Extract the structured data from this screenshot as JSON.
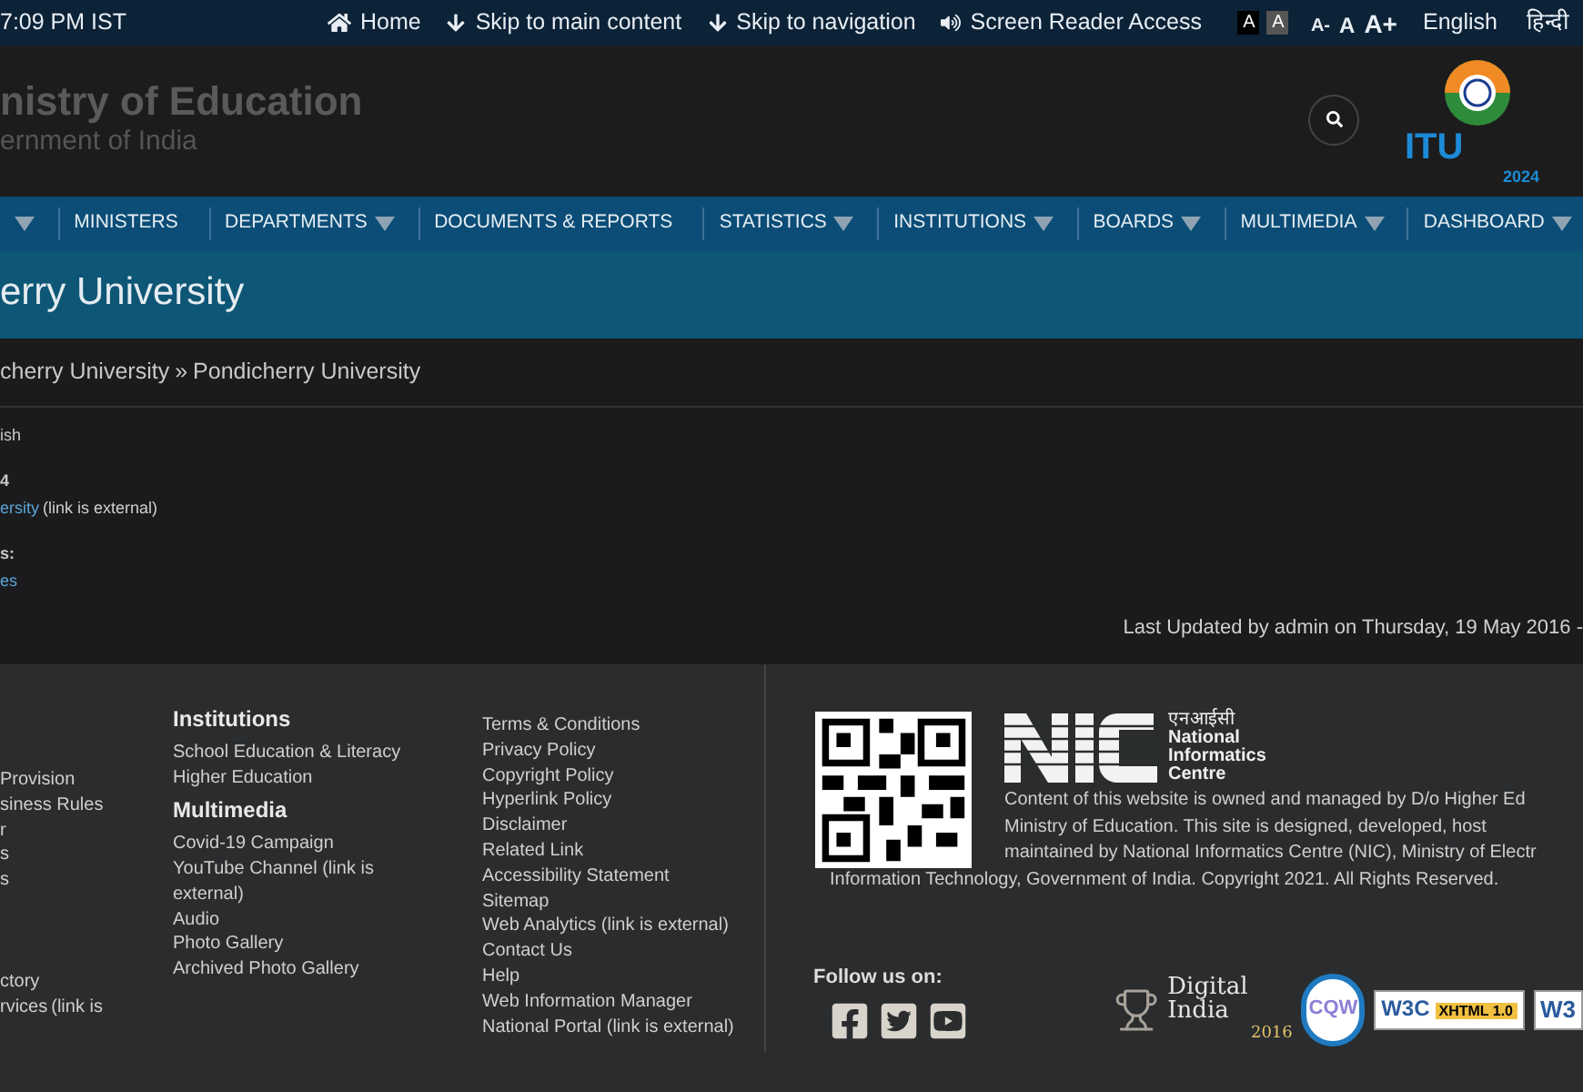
{
  "top_bar": {
    "time": "7:09 PM IST",
    "links": [
      {
        "kind": "home",
        "label": "Home"
      },
      {
        "kind": "down",
        "label": "Skip to main content"
      },
      {
        "kind": "down",
        "label": "Skip to navigation"
      },
      {
        "kind": "speaker",
        "label": "Screen Reader Access"
      }
    ],
    "contrast_buttons": [
      {
        "label": "A",
        "kind": "dark"
      },
      {
        "label": "A",
        "kind": "light"
      }
    ],
    "font_size_buttons": [
      {
        "label": "A-",
        "kind": "small"
      },
      {
        "label": "A",
        "kind": "normal"
      },
      {
        "label": "A+",
        "kind": "large"
      }
    ],
    "languages": [
      "English",
      "हिन्दी"
    ]
  },
  "header": {
    "title": "nistry of Education",
    "subtitle": "ernment of India",
    "logo_text": "ITU",
    "logo_year": "2024"
  },
  "nav": {
    "items": [
      {
        "dropdown": true
      },
      {
        "label": "MINISTERS",
        "dropdown": false
      },
      {
        "label": "DEPARTMENTS",
        "dropdown": true
      },
      {
        "label": "DOCUMENTS & REPORTS",
        "dropdown": false
      },
      {
        "label": "STATISTICS",
        "dropdown": true
      },
      {
        "label": "INSTITUTIONS",
        "dropdown": true
      },
      {
        "label": "BOARDS",
        "dropdown": true
      },
      {
        "label": "MULTIMEDIA",
        "dropdown": true
      },
      {
        "label": "DASHBOARD",
        "dropdown": true
      }
    ]
  },
  "page_title": "erry University",
  "breadcrumb": {
    "items": [
      "cherry University",
      "Pondicherry University"
    ],
    "separator": "»"
  },
  "content": {
    "lines": [
      {
        "kind": "text",
        "text": "ish"
      },
      {
        "kind": "label",
        "text": "4"
      },
      {
        "kind": "link",
        "text": "ersity",
        "note": "(link is external)"
      },
      {
        "kind": "label",
        "text": "s:"
      },
      {
        "kind": "link",
        "text": "es"
      }
    ],
    "last_updated": "Last Updated by admin on Thursday, 19 May 2016 -"
  },
  "footer": {
    "column_1": [
      {
        "text": "Provision"
      },
      {
        "text": "siness Rules"
      },
      {
        "text": "r"
      },
      {
        "text": "s"
      },
      {
        "text": "s"
      },
      {
        "text": "ctory",
        "gap": true
      },
      {
        "text": "rvices",
        "note": "(link is"
      }
    ],
    "column_2": [
      {
        "heading": "Institutions",
        "links": [
          {
            "text": "School Education & Literacy"
          },
          {
            "text": "Higher Education"
          }
        ]
      },
      {
        "heading": "Multimedia",
        "links": [
          {
            "text": "Covid-19 Campaign"
          },
          {
            "text": "YouTube Channel",
            "note": "(link is external)"
          },
          {
            "text": "Audio"
          },
          {
            "text": "Photo Gallery"
          },
          {
            "text": "Archived Photo Gallery"
          }
        ]
      }
    ],
    "column_3": [
      {
        "text": "Terms & Conditions"
      },
      {
        "text": "Privacy Policy"
      },
      {
        "text": "Copyright Policy"
      },
      {
        "text": "Hyperlink Policy"
      },
      {
        "text": "Disclaimer"
      },
      {
        "text": "Related Link"
      },
      {
        "text": "Accessibility Statement"
      },
      {
        "text": "Sitemap"
      },
      {
        "text": "Web Analytics",
        "note": "(link is external)"
      },
      {
        "text": "Contact Us"
      },
      {
        "text": "Help"
      },
      {
        "text": "Web Information Manager"
      },
      {
        "text": "National Portal",
        "note": "(link is external)"
      }
    ],
    "nic": {
      "hindi": "एनआईसी",
      "name": [
        "National",
        "Informatics",
        "Centre"
      ]
    },
    "notice_lines": [
      "Content of this website is owned and managed by D/o Higher Ed",
      "Ministry of Education. This site is designed, developed, host",
      "maintained by National Informatics Centre (NIC), Ministry of Electr",
      "Information Technology, Government of India. Copyright 2021. All Rights Reserved."
    ],
    "follow_label": "Follow us on:",
    "social": [
      {
        "kind": "facebook"
      },
      {
        "kind": "twitter"
      },
      {
        "kind": "youtube"
      }
    ],
    "badges": [
      {
        "kind": "digital_india",
        "text": "Digital India",
        "year": "2016"
      },
      {
        "kind": "cqw",
        "text": "CQW"
      },
      {
        "kind": "w3c",
        "text": "W3C",
        "version": "XHTML 1.0"
      },
      {
        "kind": "w3c_cut",
        "text": "W3"
      }
    ]
  }
}
